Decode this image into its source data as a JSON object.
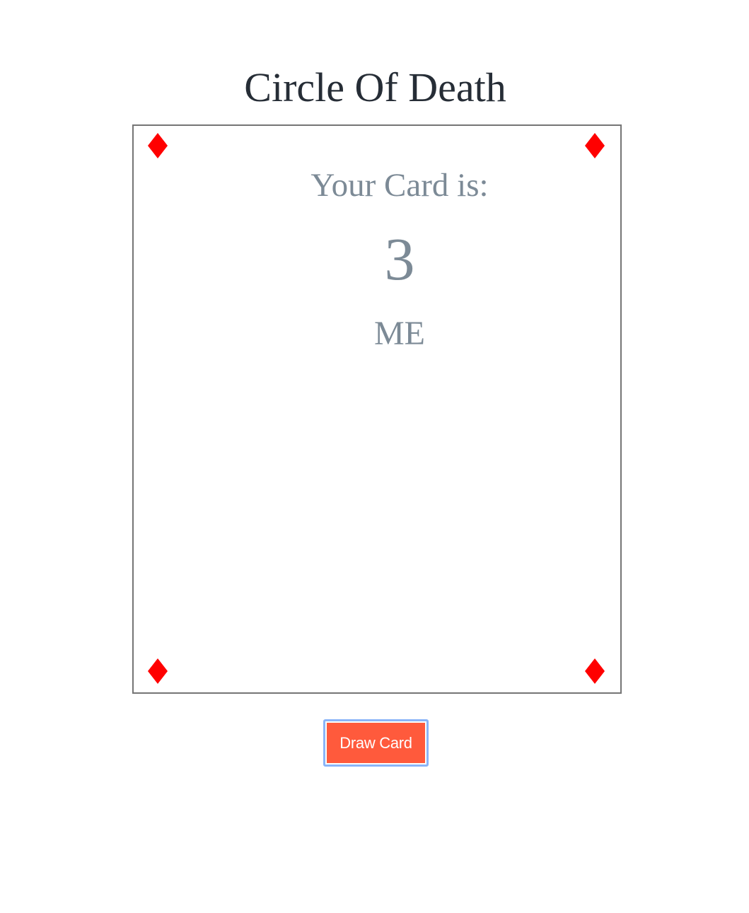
{
  "page": {
    "title": "Circle Of Death"
  },
  "card": {
    "label": "Your Card is:",
    "value": "3",
    "rule": "ME",
    "suit": "diamond-icon",
    "suit_color": "#ff0000",
    "border_color": "#757575"
  },
  "actions": {
    "draw_label": "Draw Card",
    "draw_color": "#ff5a3c"
  },
  "colors": {
    "title": "#262d36",
    "card_text": "#7c8a96"
  }
}
